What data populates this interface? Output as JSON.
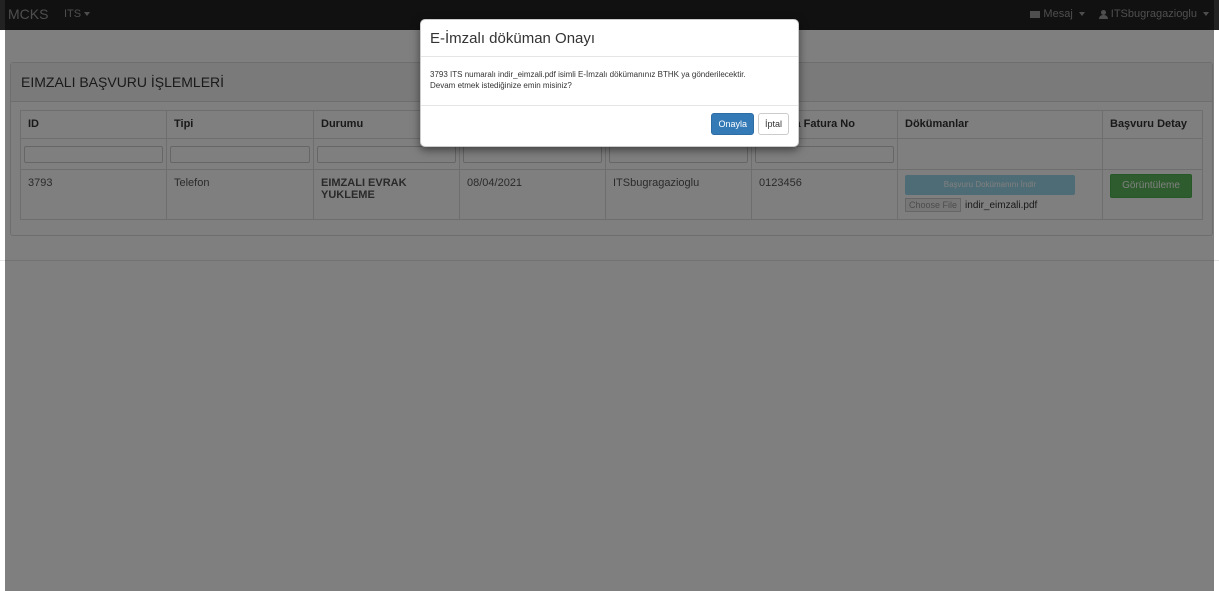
{
  "navbar": {
    "brand": "MCKS",
    "menu_label": "ITS",
    "messages_label": "Mesaj",
    "user_label": "ITSbugragazioglu"
  },
  "panel": {
    "title": "EIMZALI BAŞVURU İŞLEMLERİ"
  },
  "table": {
    "columns": [
      "ID",
      "Tipi",
      "Durumu",
      "",
      "",
      "roforma Fatura No",
      "Dökümanlar",
      "Başvuru Detay"
    ],
    "rows": [
      {
        "id": "3793",
        "tipi": "Telefon",
        "durumu": "EIMZALI EVRAK YUKLEME",
        "tarih": "08/04/2021",
        "kullanici": "ITSbugragazioglu",
        "fatura_no": "0123456",
        "download_label": "Başvuru Dokümanını İndir",
        "file_button": "Choose File",
        "file_name": "indir_eimzali.pdf",
        "detail_button": "Görüntüleme"
      }
    ]
  },
  "modal": {
    "title": "E-İmzalı döküman Onayı",
    "body_line1": "3793 ITS numaralı indir_eimzali.pdf isimli E-İmzalı dökümanınız BTHK ya gönderilecektir.",
    "body_line2": "Devam etmek istediğinize emin misiniz?",
    "confirm_label": "Onayla",
    "cancel_label": "İptal"
  }
}
